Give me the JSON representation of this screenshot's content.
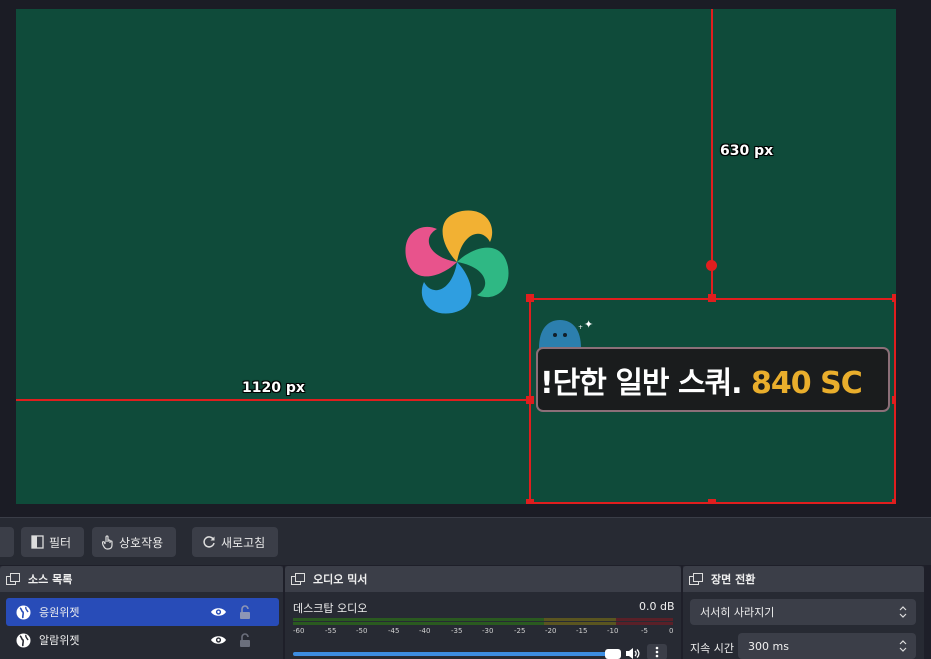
{
  "preview": {
    "guide_h_label": "1120 px",
    "guide_v_label": "630 px",
    "widget_text_white": "!단한 일반 스쿼.",
    "widget_text_gold": " 840 SC"
  },
  "toolbar": {
    "filters_label": "필터",
    "interact_label": "상호작용",
    "refresh_label": "새로고침"
  },
  "sources": {
    "title": "소스 목록",
    "items": [
      {
        "label": "응원위젯",
        "selected": true
      },
      {
        "label": "알람위젯",
        "selected": false
      }
    ]
  },
  "mixer": {
    "title": "오디오 믹서",
    "channel_name": "데스크탑 오디오",
    "channel_level": "0.0 dB",
    "scale": [
      "-60",
      "-55",
      "-50",
      "-45",
      "-40",
      "-35",
      "-30",
      "-25",
      "-20",
      "-15",
      "-10",
      "-5",
      "0"
    ]
  },
  "transitions": {
    "title": "장면 전환",
    "selected": "서서히 사라지기",
    "duration_label": "지속 시간",
    "duration_value": "300 ms"
  },
  "colors": {
    "canvas_bg": "#0f4b3a",
    "selection": "#e01e1e",
    "accent_gold": "#e9ae2c",
    "selected_row": "#284cb8"
  }
}
